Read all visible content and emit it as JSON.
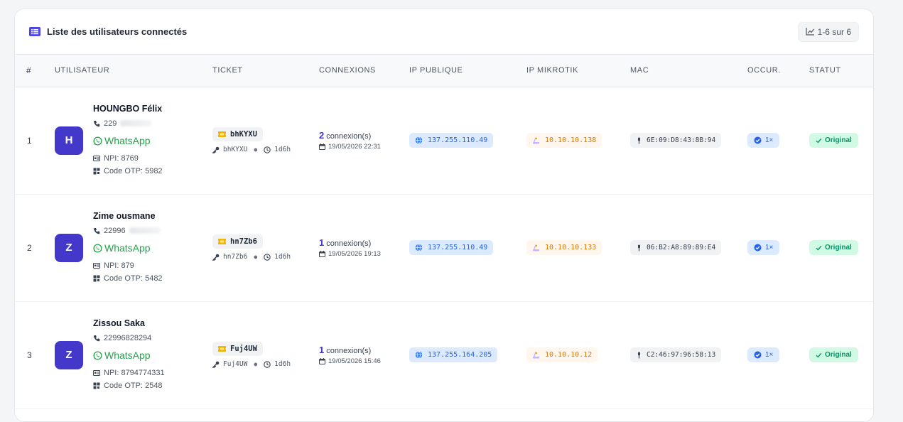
{
  "header": {
    "title": "Liste des utilisateurs connectés",
    "count": "1-6 sur 6"
  },
  "columns": [
    "#",
    "UTILISATEUR",
    "TICKET",
    "CONNEXIONS",
    "IP PUBLIQUE",
    "IP MIKROTIK",
    "MAC",
    "OCCUR.",
    "STATUT"
  ],
  "rows": [
    {
      "index": "1",
      "initial": "H",
      "name": "HOUNGBO Félix",
      "phone": "229",
      "whatsapp": "WhatsApp",
      "npi": "NPI: 8769",
      "otp": "Code OTP: 5982",
      "ticket": "bhKYXU",
      "ticket_sub": "bhKYXU",
      "duration": "1d6h",
      "conn_count": "2",
      "conn_label": "connexion(s)",
      "conn_date": "19/05/2026 22:31",
      "ip_public": "137.255.110.49",
      "ip_mikrotik": "10.10.10.138",
      "mac": "6E:09:D8:43:8B:94",
      "occurrences": "1×",
      "status": "Original"
    },
    {
      "index": "2",
      "initial": "Z",
      "name": "Zime ousmane",
      "phone": "22996",
      "whatsapp": "WhatsApp",
      "npi": "NPI: 879",
      "otp": "Code OTP: 5482",
      "ticket": "hn7Zb6",
      "ticket_sub": "hn7Zb6",
      "duration": "1d6h",
      "conn_count": "1",
      "conn_label": "connexion(s)",
      "conn_date": "19/05/2026 19:13",
      "ip_public": "137.255.110.49",
      "ip_mikrotik": "10.10.10.133",
      "mac": "06:B2:A8:89:89:E4",
      "occurrences": "1×",
      "status": "Original"
    },
    {
      "index": "3",
      "initial": "Z",
      "name": "Zissou Saka",
      "phone": "22996828294",
      "whatsapp": "WhatsApp",
      "npi": "NPI: 8794774331",
      "otp": "Code OTP: 2548",
      "ticket": "Fuj4UW",
      "ticket_sub": "Fuj4UW",
      "duration": "1d6h",
      "conn_count": "1",
      "conn_label": "connexion(s)",
      "conn_date": "19/05/2026 15:46",
      "ip_public": "137.255.164.205",
      "ip_mikrotik": "10.10.10.12",
      "mac": "C2:46:97:96:58:13",
      "occurrences": "1×",
      "status": "Original"
    }
  ],
  "colors": {
    "accent": "#4338ca",
    "whatsapp": "#22a34a",
    "ip_public_bg": "#dbeafe",
    "ip_mikrotik_text": "#d97706",
    "status_bg": "#d1fae5"
  }
}
